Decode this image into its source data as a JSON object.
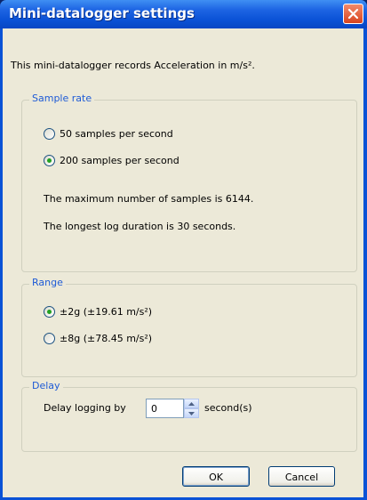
{
  "window": {
    "title": "Mini-datalogger settings",
    "close_icon": "close-icon"
  },
  "intro": "This mini-datalogger records Acceleration in m/s².",
  "sample_rate": {
    "legend": "Sample rate",
    "options": [
      {
        "label": "50 samples per second",
        "selected": false
      },
      {
        "label": "200 samples per second",
        "selected": true
      }
    ],
    "max_samples": "The maximum number of samples is 6144.",
    "longest_duration": "The longest log duration is 30 seconds."
  },
  "range": {
    "legend": "Range",
    "options": [
      {
        "label": "±2g (±19.61 m/s²)",
        "selected": true
      },
      {
        "label": "±8g (±78.45 m/s²)",
        "selected": false
      }
    ]
  },
  "delay": {
    "legend": "Delay",
    "label": "Delay logging by",
    "value": "0",
    "unit": "second(s)"
  },
  "buttons": {
    "ok": "OK",
    "cancel": "Cancel"
  },
  "colors": {
    "title_bar": "#0a52d6",
    "legend_text": "#1e5bd6",
    "dialog_bg": "#ece9d8",
    "radio_dot": "#21a121"
  }
}
